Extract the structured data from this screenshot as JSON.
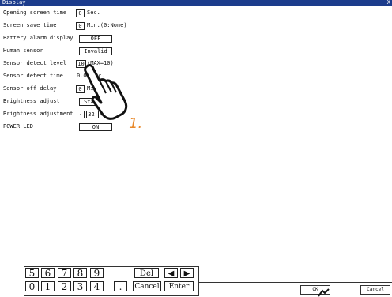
{
  "window": {
    "title": "Display",
    "corner_mark": "X"
  },
  "settings": [
    {
      "label": "Opening screen time",
      "value": "0",
      "suffix": "Sec."
    },
    {
      "label": "Screen save time",
      "value": "0",
      "suffix": "Min.(0:None)"
    },
    {
      "label": "Battery alarm display",
      "value": "OFF",
      "suffix": ""
    },
    {
      "label": "Human sensor",
      "value": "Invalid",
      "suffix": ""
    },
    {
      "label": "Sensor detect level",
      "value": "10",
      "suffix": "(MAX=10)"
    },
    {
      "label": "Sensor detect time",
      "value": "0.0",
      "suffix": "Sec."
    },
    {
      "label": "Sensor off delay",
      "value": "0",
      "suffix": "Min.Sec."
    },
    {
      "label": "Brightness adjust",
      "value": "Standard",
      "suffix": ""
    },
    {
      "label": "Brightness adjustment",
      "minus": "-",
      "value": "32",
      "plus": "+"
    },
    {
      "label": "POWER LED",
      "value": "ON",
      "suffix": ""
    }
  ],
  "keypad": {
    "row1": [
      "5",
      "6",
      "7",
      "8",
      "9"
    ],
    "row2": [
      "0",
      "1",
      "2",
      "3",
      "4"
    ],
    "dot": ".",
    "del": "Del",
    "left_arrow": "◀",
    "right_arrow": "▶",
    "cancel": "Cancel",
    "enter": "Enter"
  },
  "actions": {
    "ok": "OK",
    "cancel": "Cancel"
  },
  "annotation": {
    "step": "1."
  }
}
